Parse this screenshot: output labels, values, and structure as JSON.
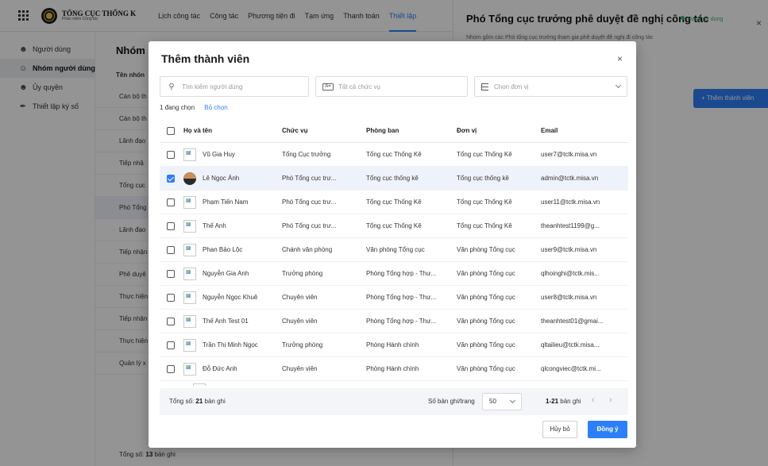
{
  "app": {
    "brand_title": "TỔNG CỤC THỐNG K",
    "brand_subtitle": "Phần mềm Công tác",
    "nav": [
      {
        "label": "Lịch công tác",
        "active": false
      },
      {
        "label": "Công tác",
        "active": false
      },
      {
        "label": "Phương tiện đi",
        "active": false
      },
      {
        "label": "Tạm ứng",
        "active": false
      },
      {
        "label": "Thanh toán",
        "active": false
      },
      {
        "label": "Thiết lập",
        "active": true
      }
    ]
  },
  "sidebar": {
    "items": [
      {
        "label": "Người dùng",
        "icon": "user-icon",
        "active": false
      },
      {
        "label": "Nhóm người dùng",
        "icon": "users-icon",
        "active": true
      },
      {
        "label": "Ủy quyền",
        "icon": "user-delegate-icon",
        "active": false
      },
      {
        "label": "Thiết lập ký số",
        "icon": "pen-sign-icon",
        "active": false
      }
    ]
  },
  "group_panel": {
    "title": "Nhóm n",
    "column_header": "Tên nhón",
    "rows": [
      "Cán bộ th",
      "Cán bộ th",
      "Lãnh đạo",
      "Tiếp nhậ",
      "Tổng cục",
      "Phó Tổng",
      "Lãnh đạo",
      "Tiếp nhận",
      "Phê duyệ",
      "Thực hiện",
      "Tiếp nhận",
      "Thực hiện",
      "Quản lý x"
    ],
    "selected_row_index": 5,
    "footer_label": "Tổng số:",
    "footer_count": "13",
    "footer_unit": "bản ghi"
  },
  "detail_panel": {
    "title": "Phó Tổng cục trưởng phê duyệt đề nghị công tác",
    "status": "Đang sử dụng",
    "description": "Nhóm gồm các Phó tổng cục trưởng tham gia phê duyệt đề nghị đi công tác",
    "add_member_label": "+ Thêm thành viên",
    "close_glyph": "×"
  },
  "modal": {
    "title": "Thêm thành viên",
    "close_glyph": "×",
    "search": {
      "placeholder": "Tìm kiếm người dùng",
      "value": ""
    },
    "role_filter": {
      "icon_text": "A=",
      "value": "Tất cả chức vụ"
    },
    "unit_filter": {
      "value": "Chọn đơn vị"
    },
    "selected_count_text": "1 đang chọn",
    "clear_selection_label": "Bỏ chọn",
    "columns": {
      "name": "Họ và tên",
      "role": "Chức vụ",
      "dept": "Phòng ban",
      "unit": "Đơn vị",
      "email": "Email"
    },
    "rows": [
      {
        "checked": false,
        "avatar": "broken-image",
        "name": "Vũ Gia Huy",
        "role": "Tổng Cục trưởng",
        "dept": "Tổng cục Thống Kê",
        "unit": "Tổng cục Thống Kê",
        "email": "user7@tctk.misa.vn"
      },
      {
        "checked": true,
        "avatar": "photo",
        "name": "Lê Ngọc Ánh",
        "role": "Phó Tổng cục trư...",
        "dept": "Tổng cục thống kê",
        "unit": "Tổng cục thống kê",
        "email": "admin@tctk.misa.vn"
      },
      {
        "checked": false,
        "avatar": "broken-image",
        "name": "Phạm Tiến Nam",
        "role": "Phó Tổng cục trư...",
        "dept": "Tổng cục Thống Kê",
        "unit": "Tổng cục Thống Kê",
        "email": "user11@tctk.misa.vn"
      },
      {
        "checked": false,
        "avatar": "broken-image",
        "name": "Thế Anh",
        "role": "Phó Tổng cục trư...",
        "dept": "Tổng cục Thống Kê",
        "unit": "Tổng cục Thống Kê",
        "email": "theanhtest1199@g..."
      },
      {
        "checked": false,
        "avatar": "broken-image",
        "name": "Phan Bảo Lộc",
        "role": "Chánh văn phòng",
        "dept": "Văn phòng Tổng cục",
        "unit": "Văn phòng Tổng cục",
        "email": "user9@tctk.misa.vn"
      },
      {
        "checked": false,
        "avatar": "broken-image",
        "name": "Nguyễn Gia Anh",
        "role": "Trưởng phòng",
        "dept": "Phòng Tổng hợp - Thư...",
        "unit": "Văn phòng Tổng cục",
        "email": "qlhoinghi@tctk.mis..."
      },
      {
        "checked": false,
        "avatar": "broken-image",
        "name": "Nguyễn Ngọc Khuê",
        "role": "Chuyên viên",
        "dept": "Phòng Tổng hợp - Thư...",
        "unit": "Văn phòng Tổng cục",
        "email": "user8@tctk.misa.vn"
      },
      {
        "checked": false,
        "avatar": "broken-image",
        "name": "Thế Anh Test 01",
        "role": "Chuyên viên",
        "dept": "Phòng Tổng hợp - Thư...",
        "unit": "Văn phòng Tổng cục",
        "email": "theanhtest01@gmai..."
      },
      {
        "checked": false,
        "avatar": "broken-image",
        "name": "Trần Thị Minh Ngọc",
        "role": "Trưởng phòng",
        "dept": "Phòng Hành chính",
        "unit": "Văn phòng Tổng cục",
        "email": "qltailieu@tctk.misa..."
      },
      {
        "checked": false,
        "avatar": "broken-image",
        "name": "Đỗ Đức Anh",
        "role": "Chuyên viên",
        "dept": "Phòng Hành chính",
        "unit": "Văn phòng Tổng cục",
        "email": "qlcongviec@tctk.mi..."
      }
    ],
    "footer": {
      "total_label": "Tổng số:",
      "total_count": "21",
      "total_unit": "bản ghi",
      "per_page_label": "Số bản ghi/trang",
      "per_page_value": "50",
      "range_value": "1-21",
      "range_unit": "bản ghi",
      "prev_glyph": "‹",
      "next_glyph": "›"
    },
    "cancel_label": "Hủy bỏ",
    "ok_label": "Đồng ý"
  },
  "colors": {
    "accent": "#2d7ff9",
    "status_green": "#3bb26b",
    "selected_row_bg": "#eef3fb"
  }
}
